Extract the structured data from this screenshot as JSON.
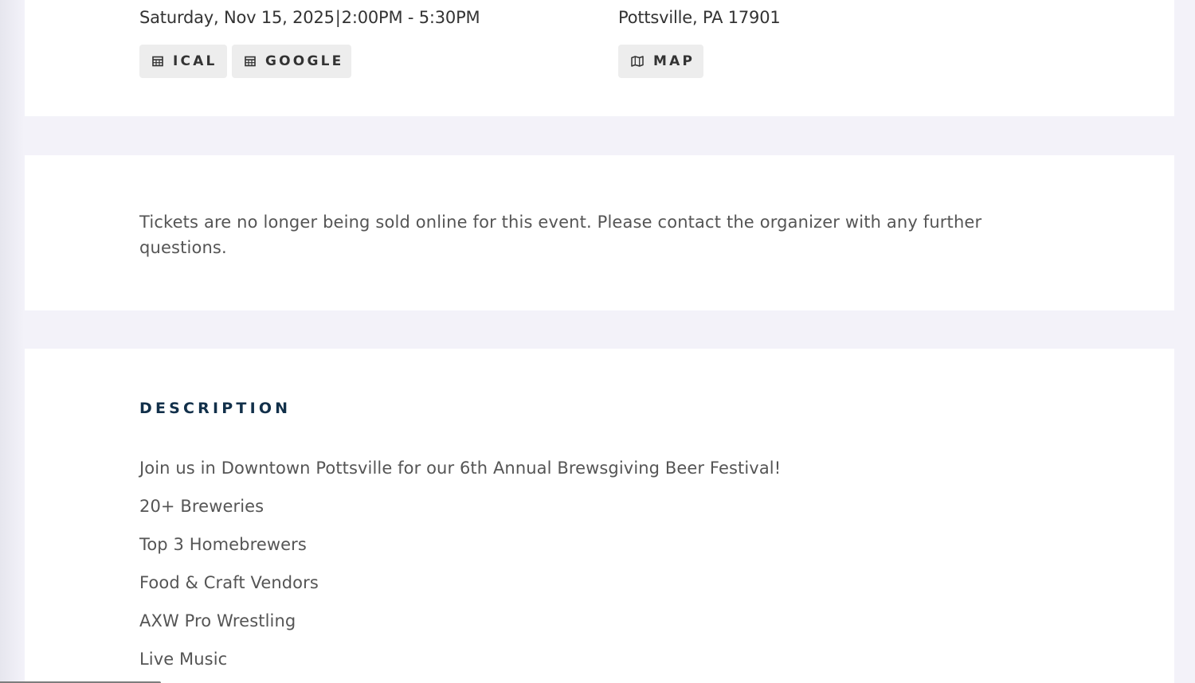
{
  "event": {
    "date": "Saturday, Nov 15, 2025",
    "time_separator": "|",
    "time": "2:00PM - 5:30PM",
    "location": "Pottsville, PA 17901"
  },
  "buttons": {
    "ical": {
      "label": "ICAL",
      "icon": "calendar-icon"
    },
    "google": {
      "label": "GOOGLE",
      "icon": "calendar-icon"
    },
    "map": {
      "label": "MAP",
      "icon": "map-icon"
    }
  },
  "tickets": {
    "message": "Tickets are no longer being sold online for this event. Please contact the organizer with any further questions."
  },
  "description": {
    "heading": "DESCRIPTION",
    "lines": [
      "Join us in Downtown Pottsville for our 6th Annual Brewsgiving Beer Festival!",
      "20+ Breweries",
      "Top 3 Homebrewers",
      "Food & Craft Vendors",
      "AXW Pro Wrestling",
      "Live Music"
    ]
  },
  "colors": {
    "page_background": "#f3f2f9",
    "card_background": "#ffffff",
    "button_background": "#ededed",
    "heading_color": "#12304a",
    "body_text": "#555555"
  }
}
